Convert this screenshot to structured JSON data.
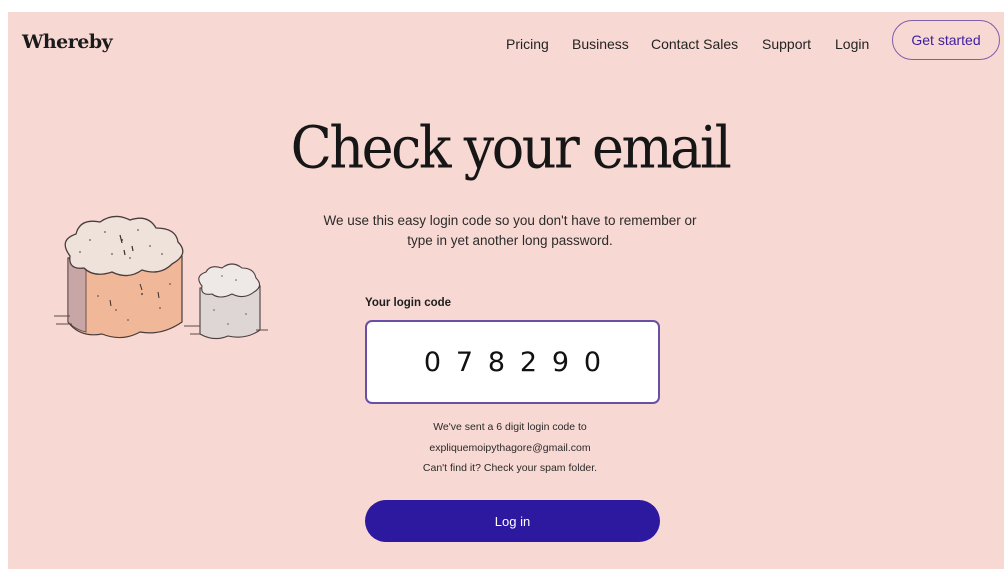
{
  "header": {
    "logo": "Whereby",
    "nav": [
      "Pricing",
      "Business",
      "Contact Sales",
      "Support",
      "Login"
    ],
    "cta_label": "Get started"
  },
  "main": {
    "title": "Check your email",
    "description_line1": "We use this easy login code so you don't have to remember or",
    "description_line2": "type in yet another long password.",
    "code_label": "Your login code",
    "code_digits": [
      "0",
      "7",
      "8",
      "2",
      "9",
      "0"
    ],
    "sent_note": "We've sent a 6 digit login code to",
    "email": "expliquemoipythagore@gmail.com",
    "spam_note": "Can't find it? Check your spam folder.",
    "login_button": "Log in"
  },
  "colors": {
    "background": "#f8d8d2",
    "accent": "#2c19a0",
    "outline": "#6a4fa6"
  }
}
